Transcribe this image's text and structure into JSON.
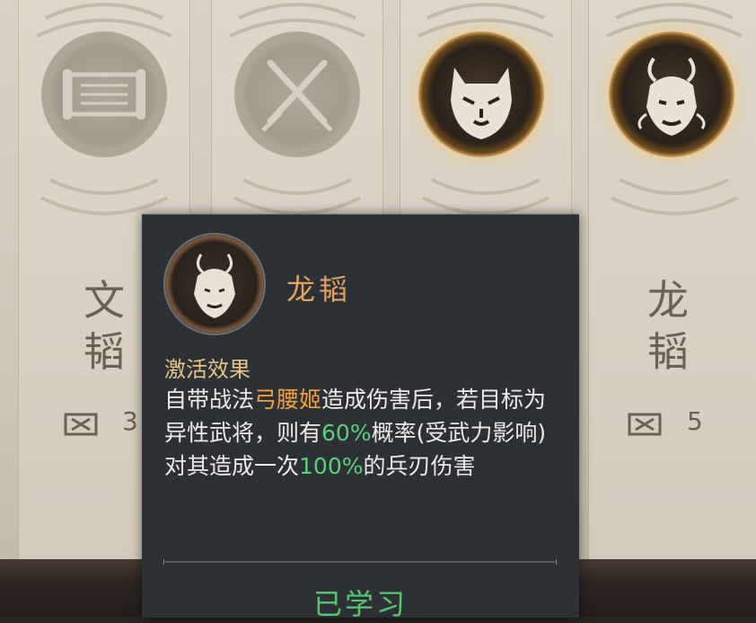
{
  "cards": [
    {
      "id": "wen",
      "name_line1": "文",
      "name_line2": "韬",
      "count": "3",
      "emblem": "scroll-icon",
      "active": false
    },
    {
      "id": "wu",
      "emblem": "crossed-swords-icon",
      "active": false
    },
    {
      "id": "hu",
      "emblem": "tiger-icon",
      "active": true
    },
    {
      "id": "long",
      "name_line1": "龙",
      "name_line2": "韬",
      "count": "5",
      "emblem": "dragon-icon",
      "active": true
    }
  ],
  "popup": {
    "title": "龙韬",
    "emblem": "dragon-icon",
    "effect_heading": "激活效果",
    "effect_segments": [
      {
        "text": "自带战法",
        "style": "normal"
      },
      {
        "text": "弓腰姬",
        "style": "orange"
      },
      {
        "text": "造成伤害后，若目标为异性武将，则有",
        "style": "normal"
      },
      {
        "text": "60%",
        "style": "green"
      },
      {
        "text": "概率(受武力影响)对其造成一次",
        "style": "normal"
      },
      {
        "text": "100%",
        "style": "green"
      },
      {
        "text": "的兵刃伤害",
        "style": "normal"
      }
    ],
    "status": "已学习"
  },
  "colors": {
    "accent_orange": "#f0a03d",
    "accent_green": "#5bd07a",
    "title_gold": "#e3a25e",
    "popup_bg": "#2d3136"
  }
}
